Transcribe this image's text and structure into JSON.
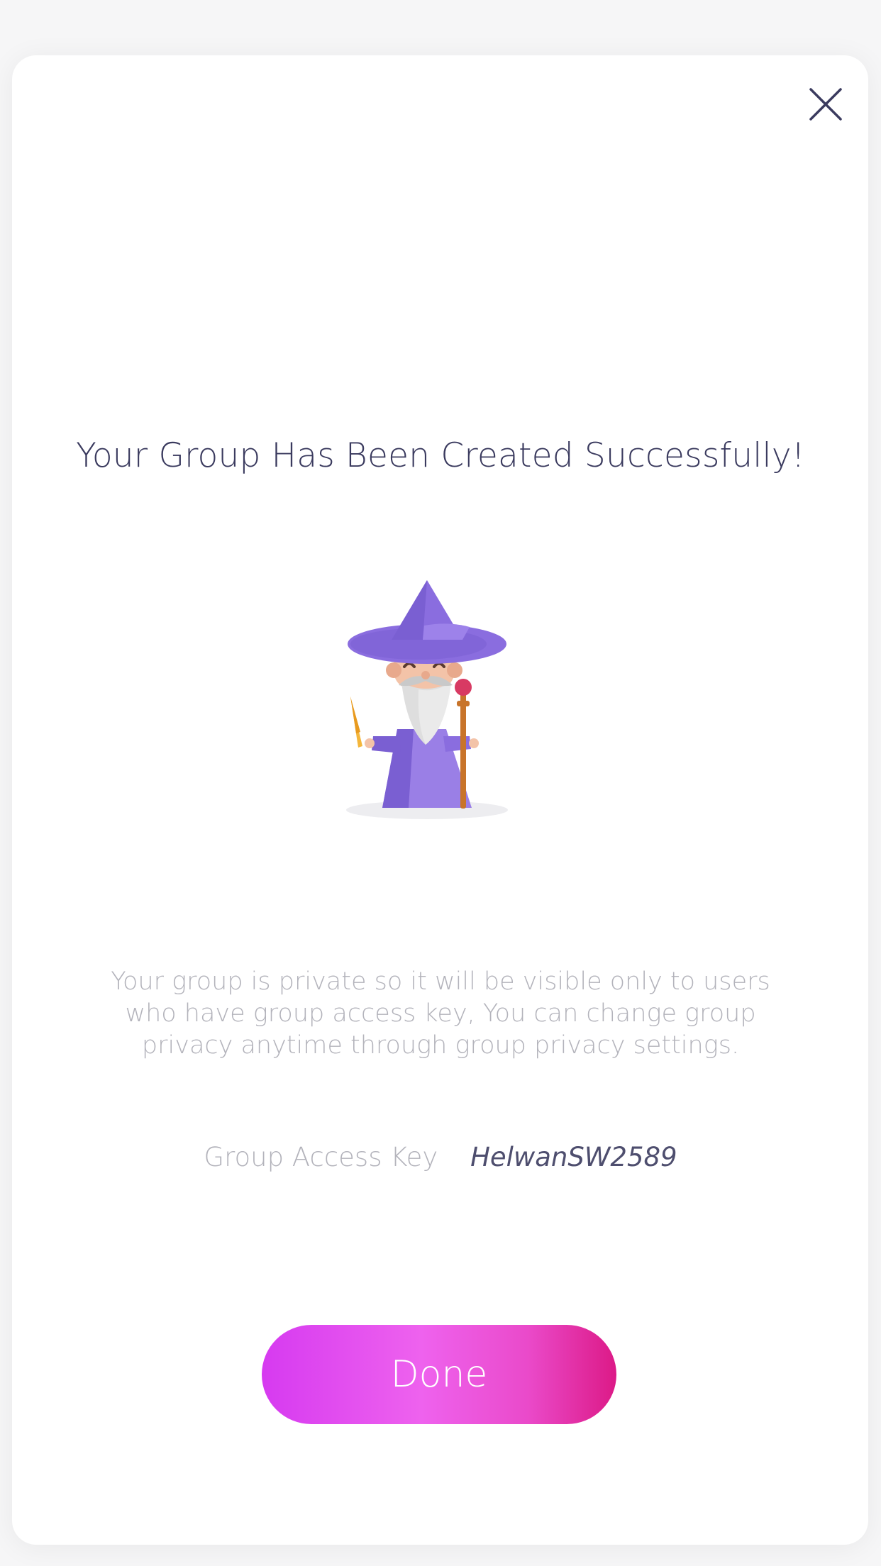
{
  "modal": {
    "title": "Your Group Has Been Created Successfully!",
    "description": "Your group is private so it will be visible only to users who have group access key, You can change group privacy anytime through group privacy settings.",
    "access_key_label": "Group Access Key",
    "access_key_value": "HelwanSW2589",
    "done_label": "Done",
    "illustration_icon": "wizard-illustration",
    "close_icon": "close-icon"
  },
  "colors": {
    "title": "#3a3a5e",
    "muted_text": "#b3b3bb",
    "key_value": "#4e4e6e",
    "button_gradient_start": "#d63af0",
    "button_gradient_end": "#dc1a87",
    "wizard_purple": "#8a6ddf"
  }
}
